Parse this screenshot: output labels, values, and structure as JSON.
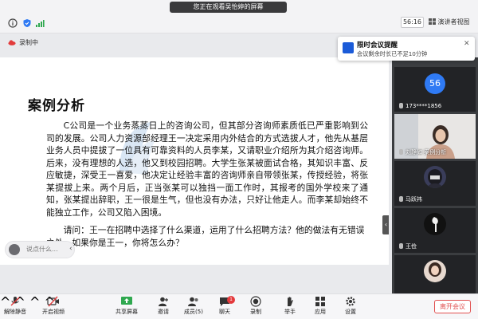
{
  "topbar": {
    "watching_notice": "您正在观看吴怡婷的屏幕",
    "timer": "56:16",
    "view_mode": "演讲者视图"
  },
  "recording": {
    "label": "录制中"
  },
  "slide": {
    "title": "案例分析",
    "body": "C公司是一个业务蒸蒸日上的咨询公司，但其部分咨询师素质低已严重影响到公司的发展。公司人力资源部经理王一决定采用内外结合的方式选拔人才，他先从基层业务人员中提拔了一位具有可靠资料的人员李某，又请职业介绍所为其介绍咨询师。后来，没有理想的人选，他又到校园招聘。大学生张某被面试合格，其知识丰富、反应敏捷，深受王一喜爱，他决定让经验丰富的咨询师亲自带领张某，传授经验，将张某提拔上来。两个月后，正当张某可以独挡一面工作时，其报考的国外学校来了通知，张某提出辞职，王一很是生气，但也没有办法，只好让他走人。而李某却始终不能独立工作，公司又陷入困境。",
    "question": "请问：王一在招聘中选择了什么渠道，运用了什么招聘方法？他的做法有无错误之处，如果你是王一，你将怎么办？"
  },
  "comment": {
    "placeholder": "说点什么..."
  },
  "reminder": {
    "title": "限时会议提醒",
    "body": "会议剩余时长已不足10分钟"
  },
  "participants": [
    {
      "avatar_text": "56",
      "name": "173****1856"
    },
    {
      "name": "刘静如 案例分析"
    },
    {
      "name": "马跃祎"
    },
    {
      "name": "王俭"
    },
    {
      "name": ""
    }
  ],
  "toolbar": {
    "mute": "解除静音",
    "video": "开启视频",
    "share": "共享屏幕",
    "invite": "邀请",
    "members": "成员(5)",
    "chat": "聊天",
    "chat_badge": "1",
    "record": "录制",
    "raise_hand": "举手",
    "apps": "应用",
    "settings": "设置",
    "leave": "离开会议"
  },
  "colors": {
    "accent": "#2f7af4",
    "leave": "#e15050",
    "panel_bg": "#3b3d40"
  }
}
